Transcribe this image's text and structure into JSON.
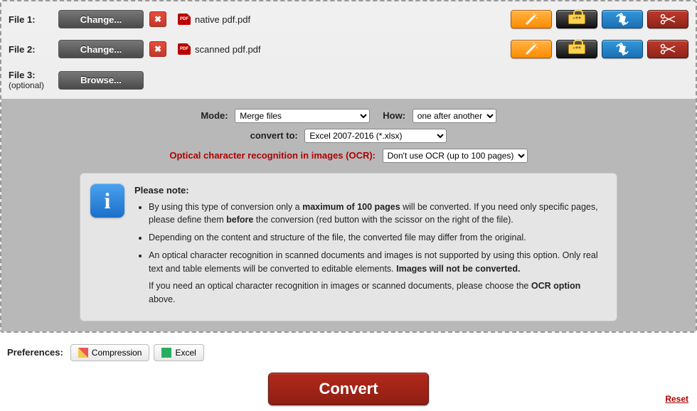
{
  "files": {
    "row1": {
      "label": "File 1:",
      "button": "Change...",
      "filename": "native pdf.pdf"
    },
    "row2": {
      "label": "File 2:",
      "button": "Change...",
      "filename": "scanned pdf.pdf"
    },
    "row3": {
      "label": "File 3:",
      "optional": "(optional)",
      "button": "Browse..."
    }
  },
  "lock_stars": "***",
  "options": {
    "mode_label": "Mode:",
    "mode_value": "Merge files",
    "how_label": "How:",
    "how_value": "one after another",
    "convert_label": "convert to:",
    "convert_value": "Excel 2007-2016 (*.xlsx)",
    "ocr_label": "Optical character recognition in images (OCR):",
    "ocr_value": "Don't use OCR (up to 100 pages)"
  },
  "note": {
    "heading": "Please note:",
    "b1_a": "By using this type of conversion only a ",
    "b1_b": "maximum of 100 pages",
    "b1_c": " will be converted. If you need only specific pages, please define them ",
    "b1_d": "before",
    "b1_e": " the conversion (red button with the scissor on the right of the file).",
    "b2": "Depending on the content and structure of the file, the converted file may differ from the original.",
    "b3_a": "An optical character recognition in scanned documents and images is not supported by using this option. Only real text and table elements will be converted to editable elements. ",
    "b3_b": "Images will not be converted.",
    "p4_a": "If you need an optical character recognition in images or scanned documents, please choose the ",
    "p4_b": "OCR option",
    "p4_c": " above."
  },
  "prefs": {
    "label": "Preferences:",
    "compression": "Compression",
    "excel": "Excel"
  },
  "convert": "Convert",
  "reset": "Reset"
}
